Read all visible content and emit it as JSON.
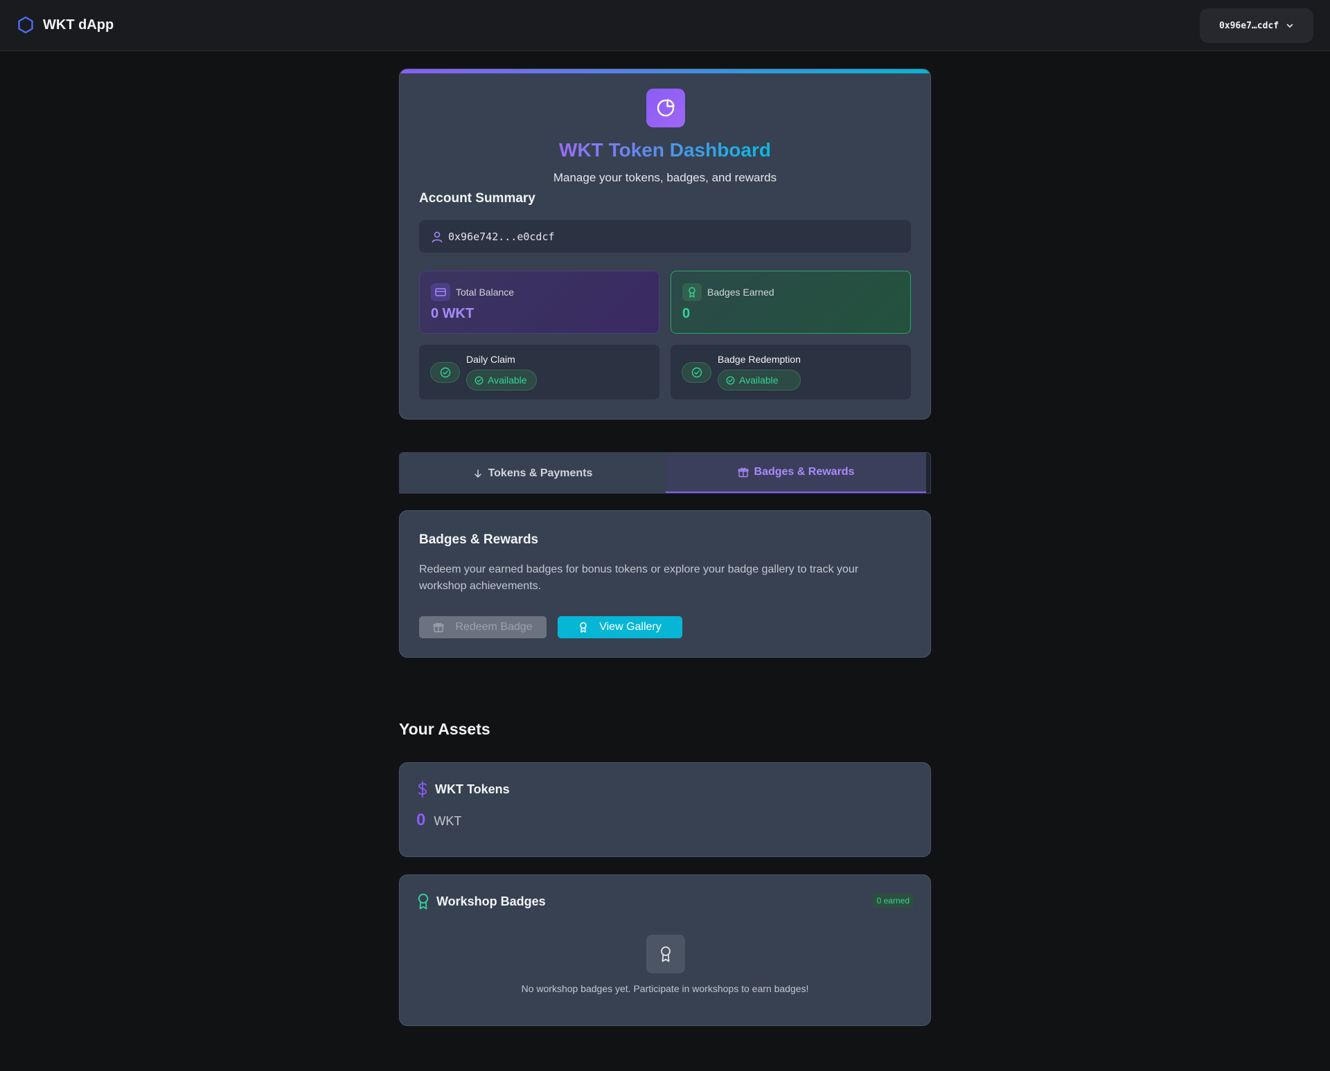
{
  "header": {
    "app_name": "WKT dApp",
    "wallet_short": "0x96e7…cdcf"
  },
  "dashboard": {
    "title": "WKT Token Dashboard",
    "subtitle": "Manage your tokens, badges, and rewards",
    "account_summary_label": "Account Summary",
    "address": "0x96e742...e0cdcf",
    "total_balance_label": "Total Balance",
    "total_balance_value": "0 WKT",
    "badges_earned_label": "Badges Earned",
    "badges_earned_value": "0",
    "daily_claim_label": "Daily Claim",
    "daily_claim_status": "Available",
    "badge_redemption_label": "Badge Redemption",
    "badge_redemption_status": "Available"
  },
  "tabs": [
    {
      "label": "Tokens & Payments",
      "active": false
    },
    {
      "label": "Badges & Rewards",
      "active": true
    }
  ],
  "rewards": {
    "title": "Badges & Rewards",
    "description": "Redeem your earned badges for bonus tokens or explore your badge gallery to track your workshop achievements.",
    "redeem_label": "Redeem Badge",
    "gallery_label": "View Gallery"
  },
  "assets": {
    "heading": "Your Assets",
    "tokens_title": "WKT Tokens",
    "tokens_amount": "0",
    "tokens_unit": "WKT",
    "badges_title": "Workshop Badges",
    "badges_tag": "0 earned",
    "badges_empty": "No workshop badges yet. Participate in workshops to earn badges!"
  },
  "colors": {
    "accent_purple": "#8b5cf6",
    "accent_cyan": "#06b6d4",
    "success_green": "#34d399",
    "brand_blue": "#3b5bdb"
  },
  "icons": [
    "hexagon-logo-icon",
    "chevron-down-icon",
    "pie-chart-icon",
    "user-icon",
    "wallet-icon",
    "award-icon",
    "check-circle-icon",
    "arrow-down-icon",
    "gift-icon",
    "dollar-icon"
  ]
}
